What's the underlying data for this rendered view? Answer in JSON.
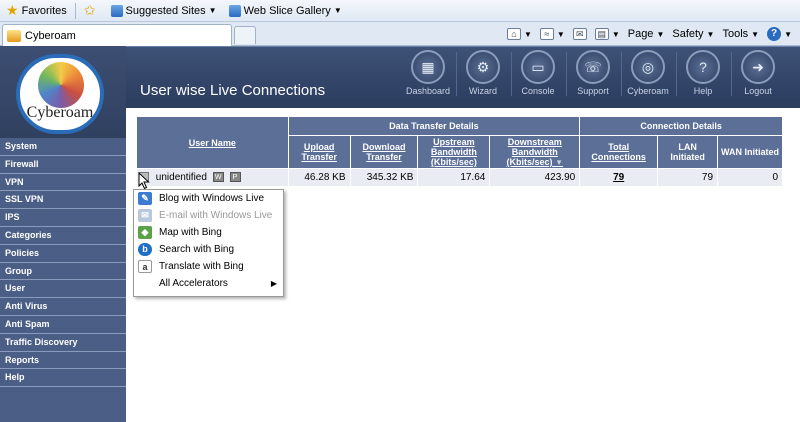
{
  "browser": {
    "favorites_label": "Favorites",
    "suggested_sites": "Suggested Sites",
    "web_slice_gallery": "Web Slice Gallery",
    "tab_title": "Cyberoam",
    "cmd": {
      "page": "Page",
      "safety": "Safety",
      "tools": "Tools"
    }
  },
  "app": {
    "logo_text": "Cyberoam",
    "page_title": "User wise Live Connections",
    "nav": [
      {
        "label": "Dashboard",
        "icon": "dashboard-icon"
      },
      {
        "label": "Wizard",
        "icon": "wizard-icon"
      },
      {
        "label": "Console",
        "icon": "console-icon"
      },
      {
        "label": "Support",
        "icon": "support-icon"
      },
      {
        "label": "Cyberoam",
        "icon": "cyberoam-icon"
      },
      {
        "label": "Help",
        "icon": "help-icon"
      },
      {
        "label": "Logout",
        "icon": "logout-icon"
      }
    ]
  },
  "sidebar": {
    "items": [
      "System",
      "Firewall",
      "VPN",
      "SSL VPN",
      "IPS",
      "Categories",
      "Policies",
      "Group",
      "User",
      "Anti Virus",
      "Anti Spam",
      "Traffic Discovery",
      "Reports",
      "Help"
    ]
  },
  "table": {
    "group_headers": {
      "user_name": "User Name",
      "data_transfer": "Data Transfer Details",
      "connection": "Connection Details"
    },
    "columns": {
      "upload": "Upload Transfer",
      "download": "Download Transfer",
      "upstream": "Upstream Bandwidth (Kbits/sec)",
      "downstream": "Downstream Bandwidth (Kbits/sec)",
      "total": "Total Connections",
      "lan": "LAN Initiated",
      "wan": "WAN Initiated"
    },
    "row": {
      "user": "unidentified",
      "upload": "46.28 KB",
      "download": "345.32 KB",
      "upstream": "17.64",
      "downstream": "423.90",
      "total": "79",
      "lan": "79",
      "wan": "0"
    }
  },
  "menu": {
    "items": [
      {
        "label": "Blog with Windows Live",
        "enabled": true,
        "icon": "blog-icon"
      },
      {
        "label": "E-mail with Windows Live",
        "enabled": false,
        "icon": "email-icon"
      },
      {
        "label": "Map with Bing",
        "enabled": true,
        "icon": "map-icon"
      },
      {
        "label": "Search with Bing",
        "enabled": true,
        "icon": "bing-icon"
      },
      {
        "label": "Translate with Bing",
        "enabled": true,
        "icon": "translate-icon"
      },
      {
        "label": "All Accelerators",
        "enabled": true,
        "icon": ""
      }
    ]
  }
}
